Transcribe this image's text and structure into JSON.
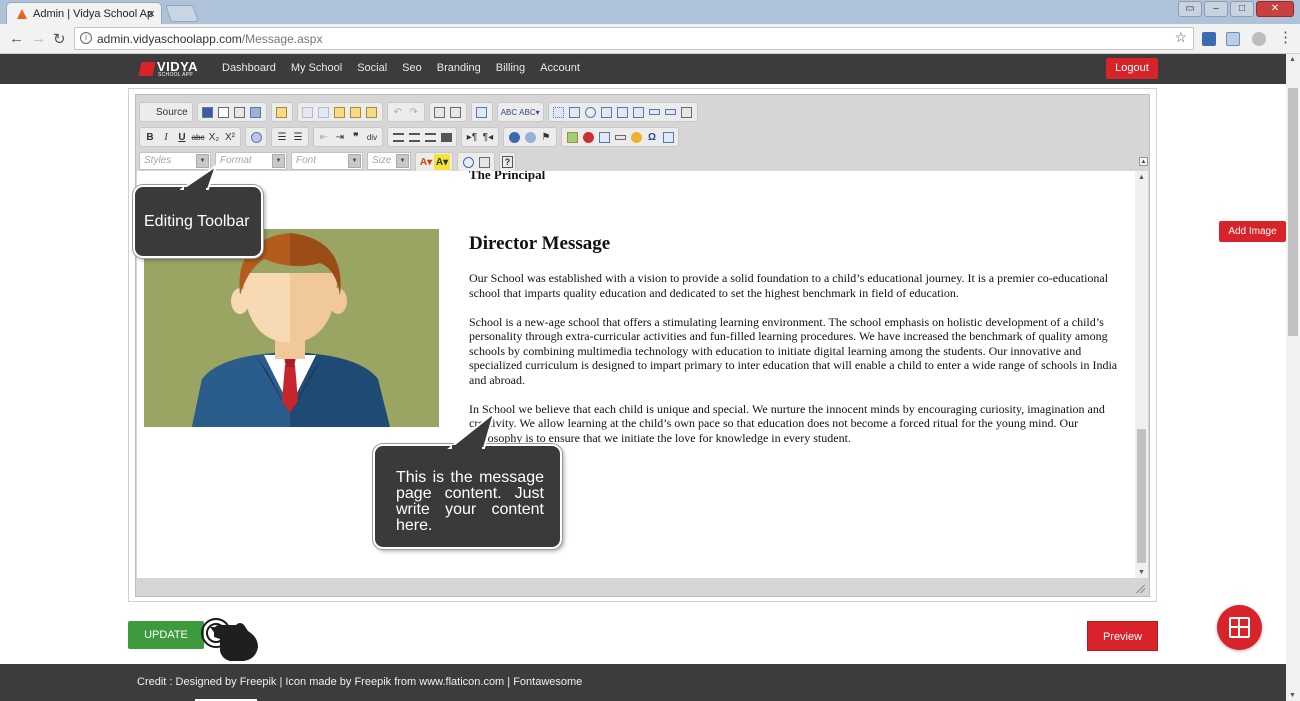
{
  "browser": {
    "tab_title": "Admin | Vidya School Ap",
    "tab_close": "×",
    "url_host": "admin.vidyaschoolapp.com",
    "url_path": "/Message.aspx"
  },
  "navbar": {
    "logo_text": "VIDYA",
    "logo_sub": "SCHOOL APP",
    "links": [
      "Dashboard",
      "My School",
      "Social",
      "Seo",
      "Branding",
      "Billing",
      "Account"
    ],
    "logout_label": "Logout"
  },
  "toolbar": {
    "source_label": "Source",
    "styles_placeholder": "Styles",
    "format_placeholder": "Format",
    "font_placeholder": "Font",
    "size_placeholder": "Size"
  },
  "content": {
    "principal_heading": "The Principal",
    "title": "Director Message",
    "paragraphs": [
      "Our School was established with a vision to provide a solid foundation to a child’s educational journey. It is a premier co-educational school that imparts quality education and dedicated to set the highest benchmark in field of education.",
      "School is a new-age school that offers a stimulating learning environment. The school emphasis on holistic development of a child’s personality through extra-curricular activities and fun-filled learning procedures. We have increased the benchmark of quality among schools by combining multimedia technology with education to initiate digital learning among the students. Our innovative and specialized curriculum is designed to impart primary to inter education that will enable a child to enter a wide range of schools in India and abroad.",
      "In School we believe that each child is unique and special. We nurture the innocent minds by encouraging curiosity, imagination and creativity. We allow learning at the child’s own pace so that education does not become a forced ritual for the young mind. Our philosophy is to ensure that we initiate the love for knowledge in every student."
    ]
  },
  "callouts": {
    "toolbar_note": "Editing Toolbar",
    "content_note": "This is the message page content. Just write your content here."
  },
  "actions": {
    "update_label": "UPDATE",
    "preview_label": "Preview",
    "add_image_label": "Add Image"
  },
  "footer": {
    "credit": "Credit : Designed by Freepik | Icon made by Freepik from www.flaticon.com | Fontawesome"
  },
  "colors": {
    "brand_red": "#d8232a",
    "navbar_bg": "#3c3c3c",
    "update_green": "#3d9a3d",
    "portrait_bg": "#9aa563"
  }
}
